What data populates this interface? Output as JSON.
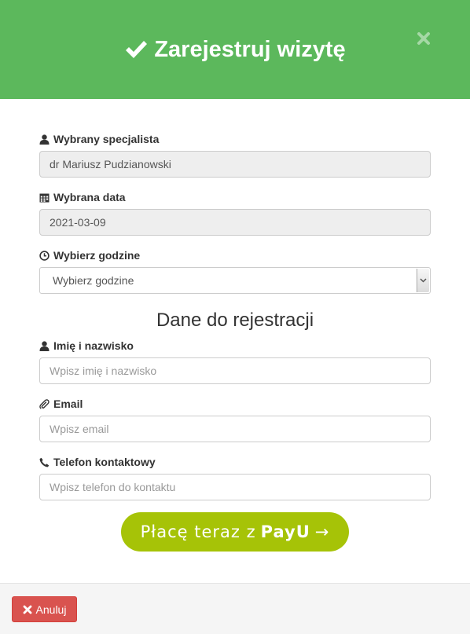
{
  "header": {
    "title": "Zarejestruj wizytę",
    "background_color": "#5cb85c"
  },
  "form": {
    "specialist": {
      "label": "Wybrany specjalista",
      "value": "dr Mariusz Pudzianowski",
      "icon": "user-icon"
    },
    "date": {
      "label": "Wybrana data",
      "value": "2021-03-09",
      "icon": "calendar-icon"
    },
    "time": {
      "label": "Wybierz godzine",
      "selected": "Wybierz godzine",
      "icon": "clock-icon"
    },
    "section_title": "Dane do rejestracji",
    "name": {
      "label": "Imię i nazwisko",
      "placeholder": "Wpisz imię i nazwisko",
      "icon": "user-icon"
    },
    "email": {
      "label": "Email",
      "placeholder": "Wpisz email",
      "icon": "paperclip-icon"
    },
    "phone": {
      "label": "Telefon kontaktowy",
      "placeholder": "Wpisz telefon do kontaktu",
      "icon": "phone-icon"
    }
  },
  "payu_button": {
    "prefix": "Płacę teraz z",
    "brand": "PayU",
    "arrow": "→",
    "color": "#a6c307"
  },
  "footer": {
    "cancel_label": "Anuluj",
    "cancel_color": "#d9534f"
  }
}
